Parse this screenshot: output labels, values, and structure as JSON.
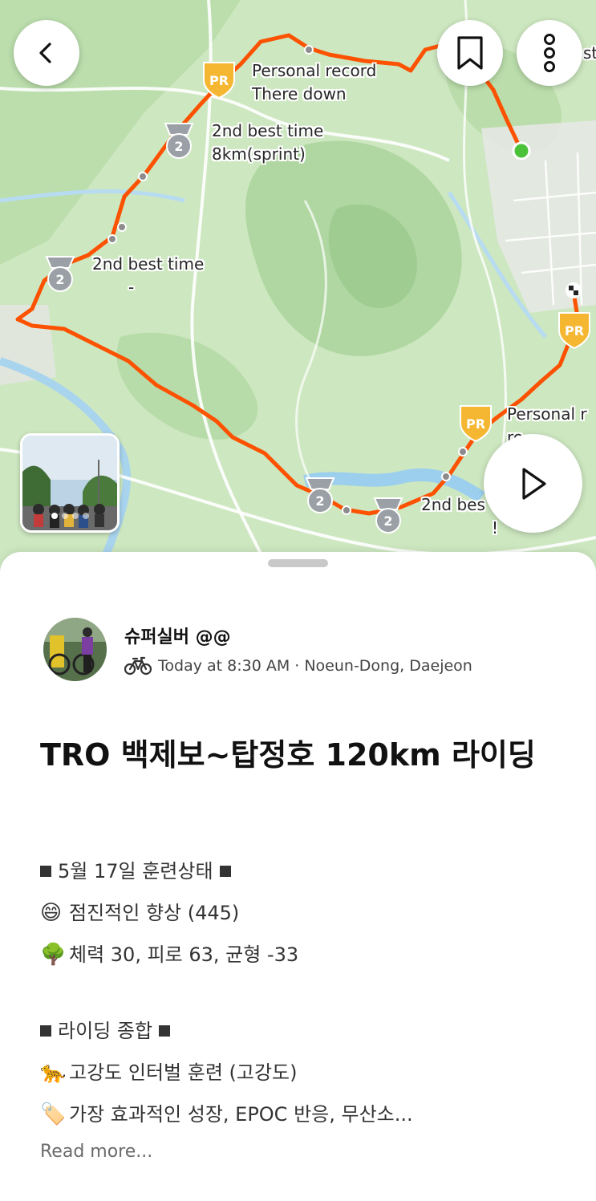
{
  "map": {
    "labels": {
      "pr_top_line1": "Personal record",
      "pr_top_line2": "There down",
      "second_top_line1": "2nd best time",
      "second_top_line2": "8km(sprint)",
      "second_left_line1": "2nd best time",
      "second_left_line2": "-",
      "pr_right_line1": "Personal r",
      "pr_right_line2": "re",
      "second_bottom_line1": "2nd bes",
      "second_bottom_line2": "!",
      "corner_fragment": "st"
    },
    "badges": {
      "pr": "PR",
      "second": "2"
    },
    "photo_count": 4,
    "colors": {
      "route": "#FC5200",
      "pr_badge": "#F5B731",
      "second_badge": "#9AA0A6",
      "start": "#4CC13A"
    }
  },
  "actions": {
    "back": "back-icon",
    "bookmark": "bookmark-icon",
    "more": "more-vertical-icon",
    "play": "play-icon"
  },
  "athlete": {
    "name": "슈퍼실버 @@",
    "sport_icon": "bike-icon",
    "meta": "Today at 8:30 AM · Noeun-Dong, Daejeon"
  },
  "activity": {
    "title": "TRO 백제보~탑정호 120km 라이딩",
    "description": {
      "status_header": "5월 17일 훈련상태",
      "status_line1_emoji": "😄",
      "status_line1": "점진적인 향상 (445)",
      "status_line2_emoji": "🌳",
      "status_line2": "체력 30, 피로 63, 균형 -33",
      "summary_header": "라이딩 종합",
      "summary_line1_emoji": "🐆",
      "summary_line1": "고강도 인터벌 훈련 (고강도)",
      "summary_line2_emoji": "🏷️",
      "summary_line2": "가장 효과적인 성장, EPOC 반응, 무산소..."
    },
    "read_more": "Read more..."
  }
}
